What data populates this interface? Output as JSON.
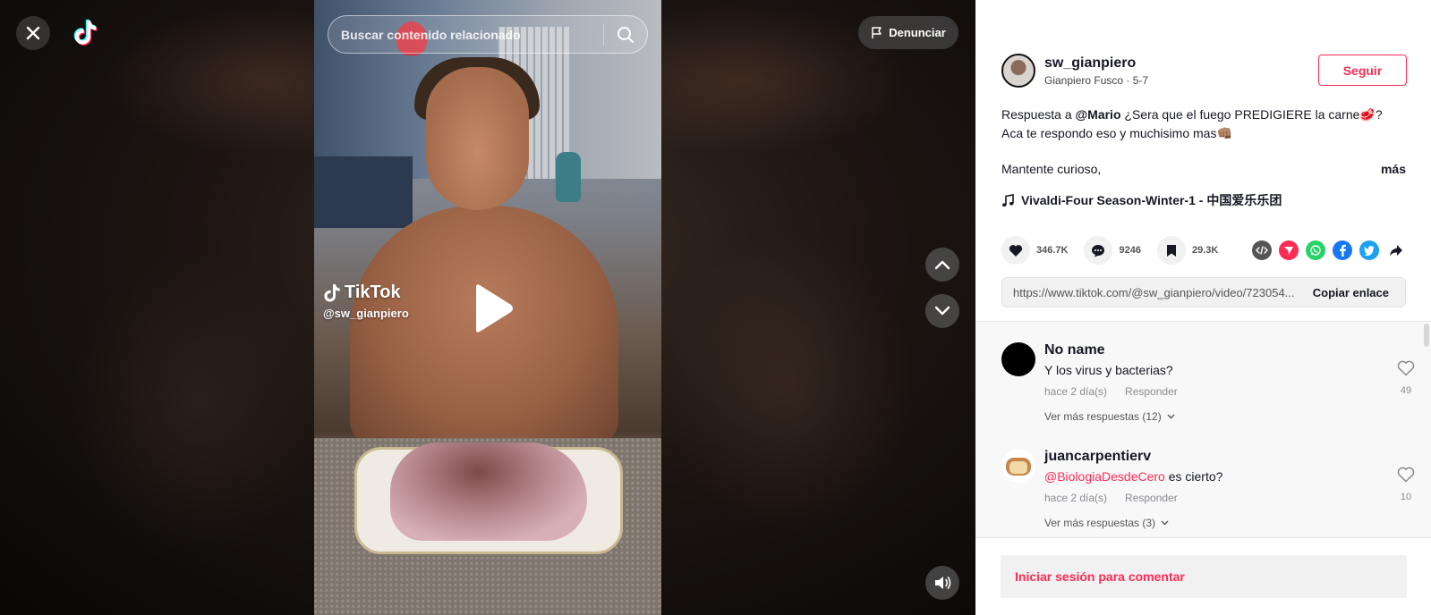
{
  "viewer": {
    "search": {
      "placeholder": "Buscar contenido relacionado"
    },
    "report_label": "Denunciar",
    "watermark": {
      "brand": "TikTok",
      "user": "@sw_gianpiero"
    }
  },
  "post": {
    "author": {
      "username": "sw_gianpiero",
      "display_name": "Gianpiero Fusco",
      "date": "5-7"
    },
    "follow_label": "Seguir",
    "description": {
      "prefix": "Respuesta a ",
      "mention": "@Mario",
      "line1_rest": " ¿Sera que el fuego PREDIGIERE la carne🥩?",
      "line2": "Aca te respondo eso y muchisimo mas👊🏽",
      "line3": "Mantente curioso,",
      "more_label": "más"
    },
    "music": "Vivaldi-Four Season-Winter-1 - 中国爱乐乐团",
    "stats": {
      "likes": "346.7K",
      "comments": "9246",
      "saves": "29.3K"
    },
    "share_icons": [
      "embed-icon",
      "send-icon",
      "whatsapp-icon",
      "facebook-icon",
      "twitter-icon",
      "share-arrow-icon"
    ],
    "link": {
      "url": "https://www.tiktok.com/@sw_gianpiero/video/723054...",
      "copy_label": "Copiar enlace"
    }
  },
  "comments": [
    {
      "name": "No name",
      "text": "Y los virus y bacterias?",
      "time": "hace 2 día(s)",
      "reply_label": "Responder",
      "likes": "49",
      "more_replies": "Ver más respuestas (12)"
    },
    {
      "name": "juancarpentierv",
      "tag": "@BiologiaDesdeCero",
      "text": " es cierto?",
      "time": "hace 2 día(s)",
      "reply_label": "Responder",
      "likes": "10",
      "more_replies": "Ver más respuestas (3)"
    }
  ],
  "login_label": "Iniciar sesión para comentar",
  "colors": {
    "accent": "#fe2c55",
    "panel_bg": "#ffffff",
    "comments_bg": "#f8f8f8"
  }
}
